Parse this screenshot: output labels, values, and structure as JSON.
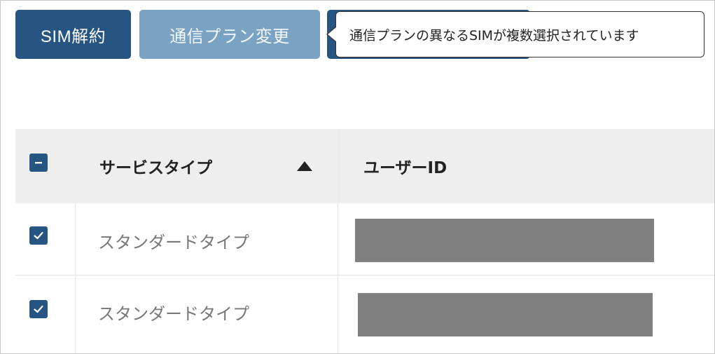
{
  "toolbar": {
    "cancel_sim_label": "SIM解約",
    "change_plan_label": "通信プラン変更"
  },
  "tooltip": {
    "text": "通信プランの異なるSIMが複数選択されています"
  },
  "table": {
    "columns": [
      {
        "label": "サービスタイプ",
        "sort": "ascending"
      },
      {
        "label": "ユーザーID"
      }
    ],
    "header_checkbox_state": "indeterminate",
    "rows": [
      {
        "checked": true,
        "service_type": "スタンダードタイプ",
        "user_id": "redacted"
      },
      {
        "checked": true,
        "service_type": "スタンダードタイプ",
        "user_id": "redacted"
      }
    ]
  },
  "colors": {
    "primary": "#275582",
    "disabled_button": "#7aa2c2",
    "header_bg": "#eeeeee",
    "redaction": "#808080"
  },
  "icons": {
    "header_checkbox": "minus-icon",
    "row_checkbox": "check-icon",
    "sort": "triangle-up-icon"
  }
}
